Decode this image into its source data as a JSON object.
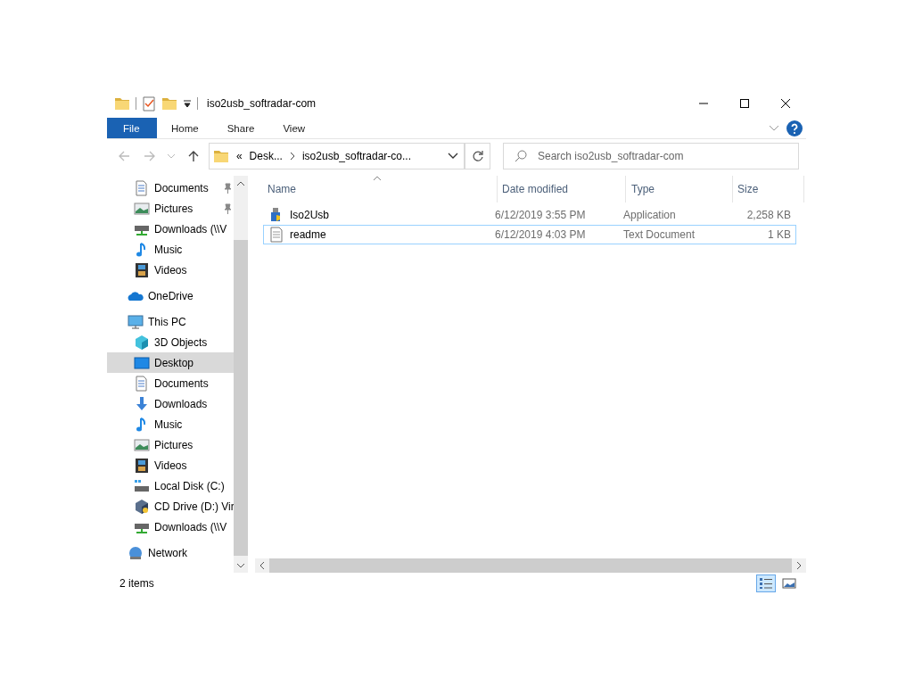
{
  "window": {
    "title": "iso2usb_softradar-com"
  },
  "ribbon_tabs": [
    {
      "label": "File",
      "kind": "file"
    },
    {
      "label": "Home",
      "kind": "tab"
    },
    {
      "label": "Share",
      "kind": "tab"
    },
    {
      "label": "View",
      "kind": "tab"
    }
  ],
  "address_bar": {
    "overflow": "«",
    "segments": [
      "Desk...",
      "iso2usb_softradar-co..."
    ]
  },
  "search": {
    "placeholder": "Search iso2usb_softradar-com"
  },
  "quick_access_items": [
    {
      "label": "Documents",
      "kind": "documents",
      "pinned": true,
      "selected": false
    },
    {
      "label": "Pictures",
      "kind": "pictures",
      "pinned": true,
      "selected": false
    },
    {
      "label": "Downloads (\\\\V",
      "kind": "netdrive",
      "pinned": false,
      "selected": false
    },
    {
      "label": "Music",
      "kind": "music",
      "pinned": false,
      "selected": false
    },
    {
      "label": "Videos",
      "kind": "videos",
      "pinned": false,
      "selected": false
    }
  ],
  "nav_tree": [
    {
      "label": "OneDrive",
      "kind": "cloud",
      "selected": false
    },
    {
      "label": "This PC",
      "kind": "pc",
      "selected": false,
      "children": [
        {
          "label": "3D Objects",
          "kind": "cube",
          "selected": false
        },
        {
          "label": "Desktop",
          "kind": "desktop",
          "selected": true
        },
        {
          "label": "Documents",
          "kind": "documents",
          "selected": false
        },
        {
          "label": "Downloads",
          "kind": "download",
          "selected": false
        },
        {
          "label": "Music",
          "kind": "music",
          "selected": false
        },
        {
          "label": "Pictures",
          "kind": "pictures",
          "selected": false
        },
        {
          "label": "Videos",
          "kind": "videos",
          "selected": false
        },
        {
          "label": "Local Disk (C:)",
          "kind": "disk",
          "selected": false
        },
        {
          "label": "CD Drive (D:) Vir",
          "kind": "cd",
          "selected": false
        },
        {
          "label": "Downloads (\\\\V",
          "kind": "netdrive",
          "selected": false
        }
      ]
    },
    {
      "label": "Network",
      "kind": "network",
      "selected": false
    }
  ],
  "file_list": {
    "columns": [
      "Name",
      "Date modified",
      "Type",
      "Size"
    ],
    "rows": [
      {
        "name": "Iso2Usb",
        "kind": "app",
        "date": "6/12/2019 3:55 PM",
        "type": "Application",
        "size": "2,258 KB",
        "focused": false
      },
      {
        "name": "readme",
        "kind": "text",
        "date": "6/12/2019 4:03 PM",
        "type": "Text Document",
        "size": "1 KB",
        "focused": true
      }
    ]
  },
  "status_bar": {
    "item_count": "2 items"
  }
}
